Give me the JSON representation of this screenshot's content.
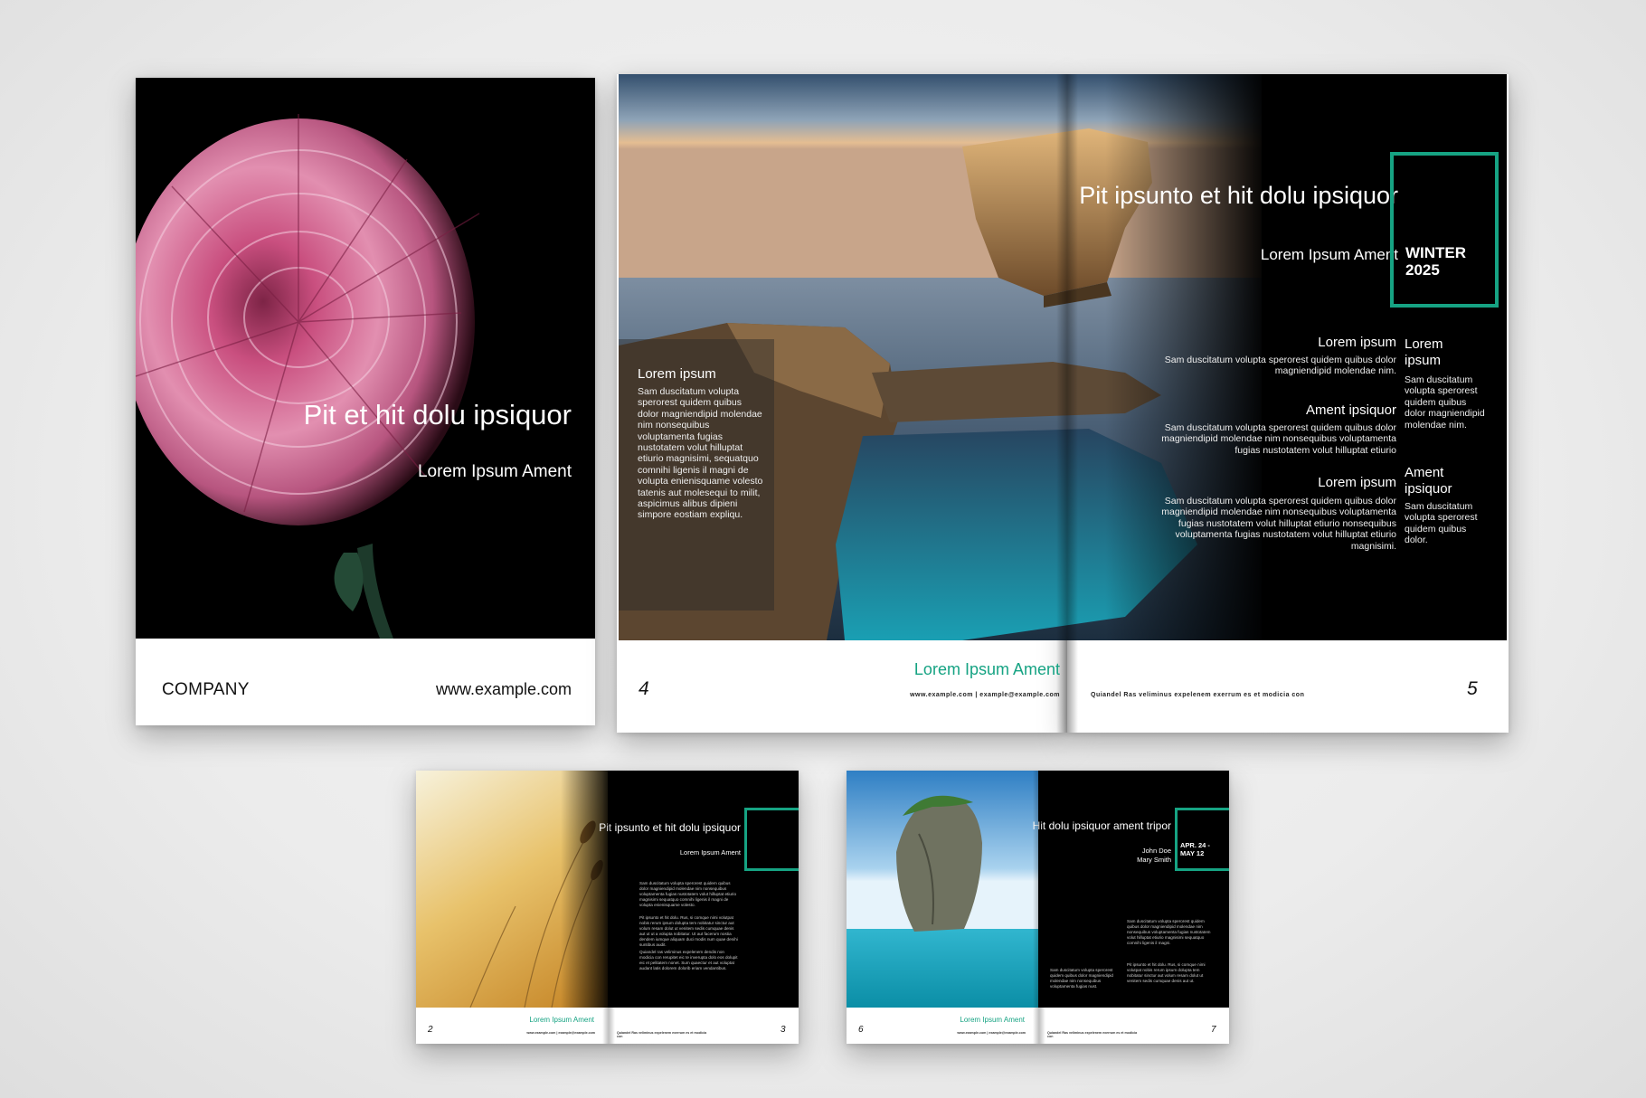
{
  "cover": {
    "title": "Pit et hit dolu ipsiquor",
    "subtitle": "Lorem Ipsum Ament",
    "company": "COMPANY",
    "url": "www.example.com"
  },
  "spread": {
    "title": "Pit ipsunto et hit dolu ipsiquor",
    "subtitle": "Lorem Ipsum Ament",
    "badge": "WINTER 2025",
    "left_heading": "Lorem ipsum",
    "left_body": "Sam duscitatum volupta sperorest quidem quibus dolor magniendipid molendae nim nonsequibus voluptamenta fugias nustotatem volut hilluptat etiurio magnisimi, sequatquo comnihi ligenis il magni de volupta enienisquame volesto tatenis aut molesequi to milit, aspicimus alibus dipieni simpore eostiam expliqu.",
    "columns": [
      {
        "heading": "Lorem ipsum",
        "body": "Sam duscitatum volupta sperorest quidem quibus dolor magniendipid molendae nim."
      },
      {
        "heading": "Ament ipsiquor",
        "body": "Sam duscitatum volupta sperorest quidem quibus dolor magniendipid molendae nim nonsequibus voluptamenta fugias nustotatem volut hilluptat etiurio"
      },
      {
        "heading": "Lorem ipsum",
        "body": "Sam duscitatum volupta sperorest quidem quibus dolor magniendipid molendae nim nonsequibus voluptamenta fugias nustotatem volut hilluptat etiurio nonsequibus voluptamenta fugias nustotatem volut hilluptat etiurio magnisimi."
      }
    ],
    "right_col": [
      {
        "heading": "Lorem ipsum",
        "body": "Sam duscitatum volupta sperorest quidem quibus dolor magniendipid molendae nim."
      },
      {
        "heading": "Ament ipsiquor",
        "body": "Sam duscitatum volupta sperorest quidem quibus dolor."
      }
    ],
    "footer_ament": "Lorem Ipsum Ament",
    "footer_url": "www.example.com | example@example.com",
    "footer_right": "Quiandel Ras veliminus expelenem exerrum es et modicia con",
    "page_left": "4",
    "page_right": "5"
  },
  "small1": {
    "title": "Pit ipsunto et hit dolu ipsiquor",
    "subtitle": "Lorem Ipsum Ament",
    "body1": "Sam duscitatum volupta sperorest quidem quibus dolor magniendipid molendae nim nonsequibus voluptamenta fugias nustotatem volut hilluptat etiurio magnisimi sequatquo comnihi ligenis il magni de volupta enienisquame volesto.",
    "body2": "Pit ipsunto et hit dolu. Rus, si comque nimi volutpat nobis rerum ipsum dolupta tem nobitatur sinctur aut volum resam dolut ut venitem sedis cumquae denis aut ut ut a volupta nobitatur. Ut aut facerum nostia dendem iumque aliquam duci modis num quae denihi suntibus audit.",
    "body3": "Quiandel ras veliminus expelenem dendis non modicia con rerupitet eic te inverupta dolo eos dolupit eic et pelitatem nonet. Sum quaectur et aut voluptat audant latis dolorem dolorib eriam vendantibus.",
    "ament": "Lorem Ipsum Ament",
    "url": "www.example.com | example@example.com",
    "url_right": "Quiandel Ras veliminus expelenem exerrum es et modicia con",
    "page_left": "2",
    "page_right": "3"
  },
  "small2": {
    "title": "Hit dolu ipsiquor ament tripor",
    "names": "John Doe",
    "names2": "Mary Smith",
    "badge": "APR. 24 - MAY 12",
    "body1": "Sam duscitatum volupta sperorest quidem quibus dolor magniendipid molendae nim nonsequibus voluptamenta fugias nustotatem volut hilluptat etiurio magnisimi sequatquo comnihi ligenis il magni.",
    "body2": "Pit ipsunto et hit dolu. Rus, si comque nimi volutpat nobis rerum ipsum dolupta tem nobitatur sinctur aut volum resam dolut ut venitem sedis cumquae denis aut ut.",
    "body_left": "Sam duscitatum volupta sperorest quidem quibus dolor magniendipid molendae nim nonsequibus voluptamenta fugias nust.",
    "ament": "Lorem Ipsum Ament",
    "url": "www.example.com | example@example.com",
    "url_right": "Quiandel Ras veliminus expelenem exerrum es et modicia con",
    "page_left": "6",
    "page_right": "7"
  },
  "colors": {
    "accent": "#16a383",
    "panel": "#000000"
  }
}
